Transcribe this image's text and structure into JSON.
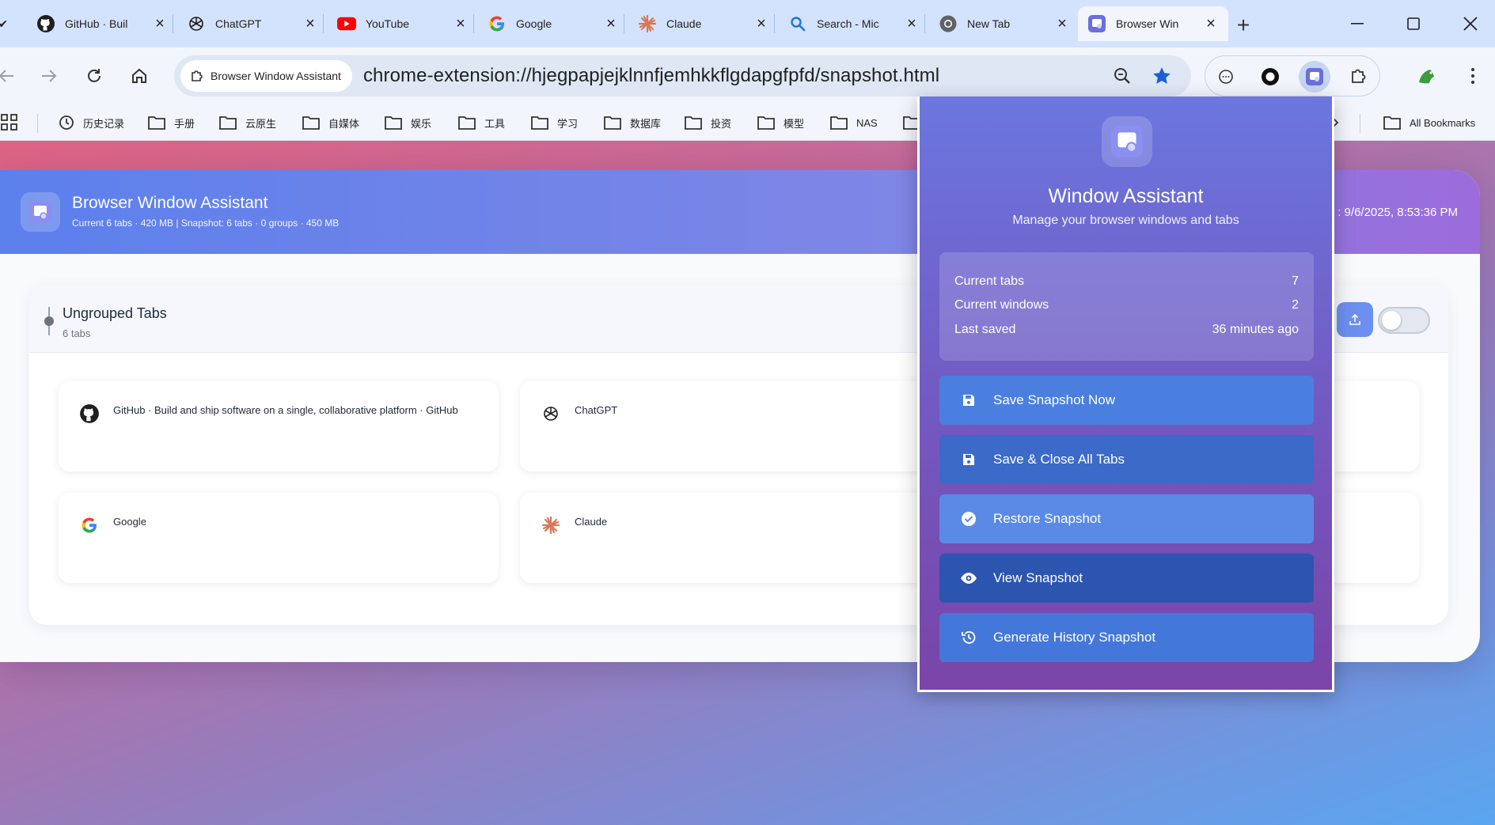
{
  "tabs": [
    {
      "title": "GitHub · Buil",
      "icon": "github-icon"
    },
    {
      "title": "ChatGPT",
      "icon": "chatgpt-icon"
    },
    {
      "title": "YouTube",
      "icon": "youtube-icon"
    },
    {
      "title": "Google",
      "icon": "google-icon"
    },
    {
      "title": "Claude",
      "icon": "claude-icon"
    },
    {
      "title": "Search - Mic",
      "icon": "search-icon"
    },
    {
      "title": "New Tab",
      "icon": "chrome-icon"
    },
    {
      "title": "Browser Win",
      "icon": "extension-icon"
    }
  ],
  "toolbar": {
    "site_chip": "Browser Window Assistant",
    "url": "chrome-extension://hjegpapjejklnnfjemhkkflgdapgfpfd/snapshot.html"
  },
  "bookmarks": [
    {
      "label": "历史记录"
    },
    {
      "label": "手册"
    },
    {
      "label": "云原生"
    },
    {
      "label": "自媒体"
    },
    {
      "label": "娱乐"
    },
    {
      "label": "工具"
    },
    {
      "label": "学习"
    },
    {
      "label": "数据库"
    },
    {
      "label": "投资"
    },
    {
      "label": "模型"
    },
    {
      "label": "NAS"
    },
    {
      "label": "All Bookmarks"
    }
  ],
  "page": {
    "title": "Browser Window Assistant",
    "subtitle": "Current 6 tabs · 420 MB | Snapshot: 6 tabs · 0 groups · 450 MB",
    "timestamp": ": 9/6/2025, 8:53:36 PM",
    "group": {
      "title": "Ungrouped Tabs",
      "count": "6 tabs"
    },
    "cards": [
      {
        "title": "GitHub · Build and ship software on a single, collaborative platform · GitHub"
      },
      {
        "title": "ChatGPT"
      },
      {
        "title": "Google"
      },
      {
        "title": "Claude"
      }
    ]
  },
  "popup": {
    "title": "Window Assistant",
    "subtitle": "Manage your browser windows and tabs",
    "stats": [
      {
        "label": "Current tabs",
        "value": "7"
      },
      {
        "label": "Current windows",
        "value": "2"
      },
      {
        "label": "Last saved",
        "value": "36 minutes ago"
      }
    ],
    "buttons": [
      {
        "label": "Save Snapshot Now",
        "icon": "save-icon",
        "color": "#4a7fe0"
      },
      {
        "label": "Save & Close All Tabs",
        "icon": "save-icon",
        "color": "#3b6ac8"
      },
      {
        "label": "Restore Snapshot",
        "icon": "check-circle-icon",
        "color": "#5a8ae6"
      },
      {
        "label": "View Snapshot",
        "icon": "eye-icon",
        "color": "#2c55b0"
      },
      {
        "label": "Generate History Snapshot",
        "icon": "history-icon",
        "color": "#4378da"
      }
    ]
  },
  "colors": {
    "accent": "#5c80ec",
    "popup_top": "#6b76df",
    "popup_bottom": "#7a44a8",
    "tab_strip": "#d3e3fd"
  }
}
